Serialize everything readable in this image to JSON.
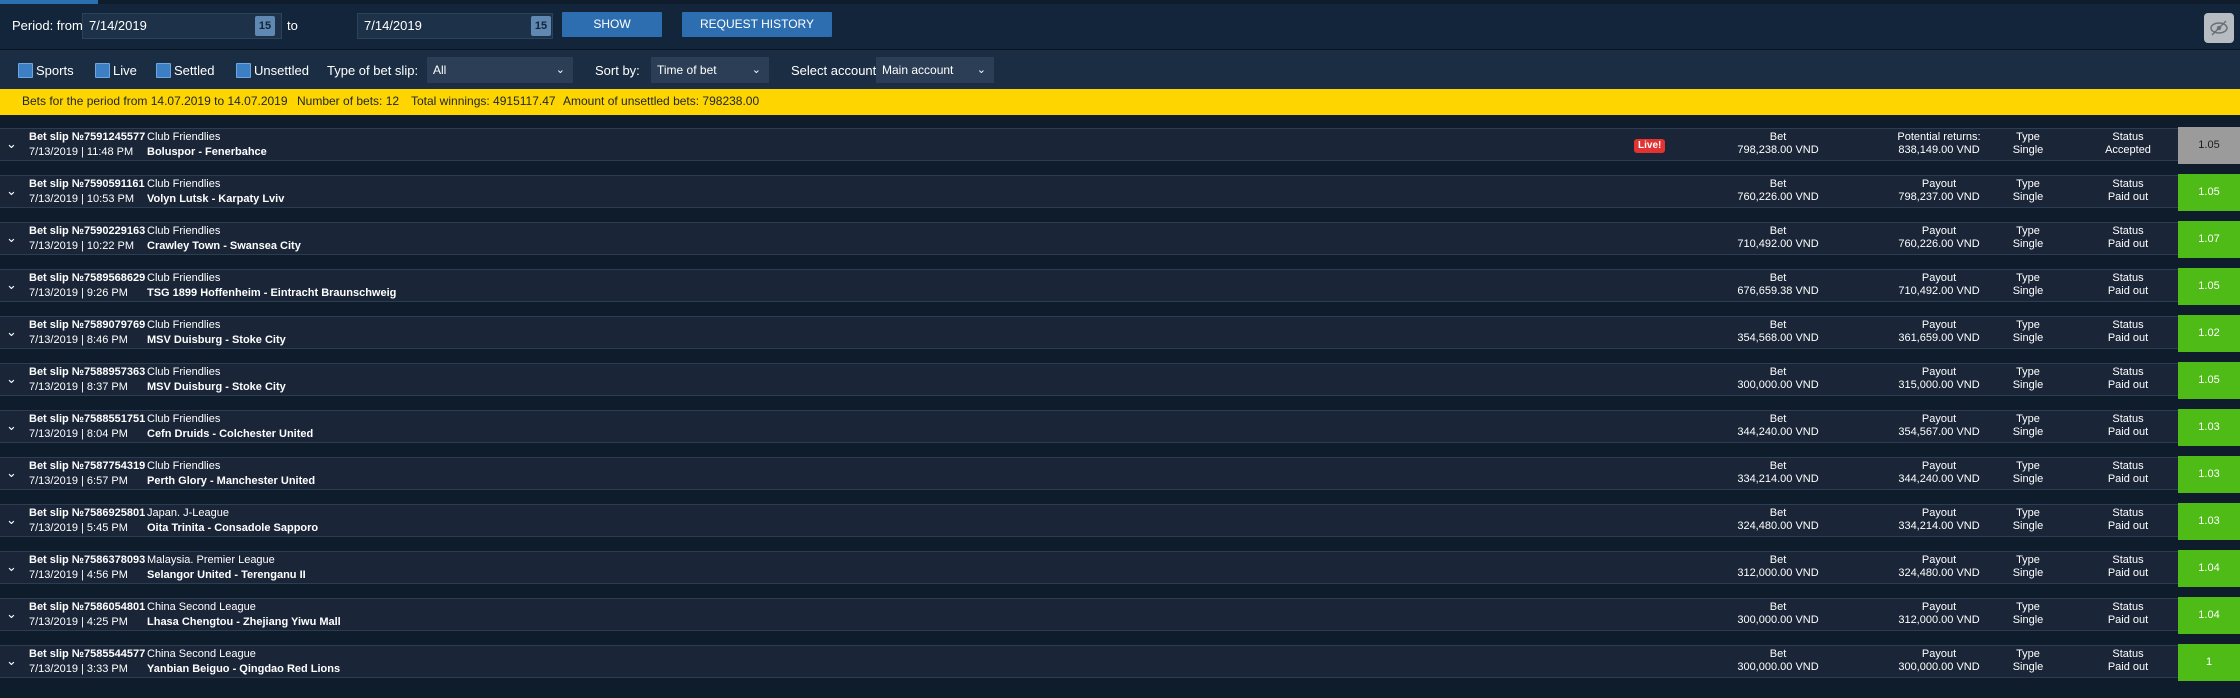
{
  "filters": {
    "period_from_label": "Period: from",
    "from_date": "7/14/2019",
    "to_label": "to",
    "to_date": "7/14/2019",
    "calendar_icon_text": "15",
    "show_button": "SHOW",
    "history_button": "REQUEST HISTORY"
  },
  "options": {
    "checkboxes": [
      "Sports",
      "Live",
      "Settled",
      "Unsettled"
    ],
    "bet_type_label": "Type of bet slip:",
    "bet_type_value": "All",
    "sort_label": "Sort by:",
    "sort_value": "Time of bet",
    "account_label": "Select account:",
    "account_value": "Main account"
  },
  "summary": {
    "period": "Bets for the period from 14.07.2019 to 14.07.2019",
    "count": "Number of bets: 12",
    "winnings": "Total winnings: 4915117.47",
    "unsettled": "Amount of unsettled bets: 798238.00"
  },
  "labels": {
    "bet": "Bet",
    "type": "Type",
    "status": "Status",
    "live": "Live!"
  },
  "colors": {
    "summary_bar": "#ffd500",
    "odds_paid": "#4ebb17",
    "odds_pending": "#9b9b9b",
    "live_badge": "#e23232",
    "button": "#2c6eb0"
  },
  "bets": [
    {
      "slip": "Bet slip №7591245577",
      "datetime": "7/13/2019 | 11:48 PM",
      "league": "Club Friendlies",
      "match": "Boluspor - Fenerbahce",
      "live": true,
      "bet": "798,238.00 VND",
      "payout_label": "Potential returns:",
      "payout": "838,149.00 VND",
      "type": "Single",
      "status": "Accepted",
      "odds": "1.05",
      "pending": true
    },
    {
      "slip": "Bet slip №7590591161",
      "datetime": "7/13/2019 | 10:53 PM",
      "league": "Club Friendlies",
      "match": "Volyn Lutsk - Karpaty Lviv",
      "live": false,
      "bet": "760,226.00 VND",
      "payout_label": "Payout",
      "payout": "798,237.00 VND",
      "type": "Single",
      "status": "Paid out",
      "odds": "1.05",
      "pending": false
    },
    {
      "slip": "Bet slip №7590229163",
      "datetime": "7/13/2019 | 10:22 PM",
      "league": "Club Friendlies",
      "match": "Crawley Town - Swansea City",
      "live": false,
      "bet": "710,492.00 VND",
      "payout_label": "Payout",
      "payout": "760,226.00 VND",
      "type": "Single",
      "status": "Paid out",
      "odds": "1.07",
      "pending": false
    },
    {
      "slip": "Bet slip №7589568629",
      "datetime": "7/13/2019 | 9:26 PM",
      "league": "Club Friendlies",
      "match": "TSG 1899 Hoffenheim - Eintracht Braunschweig",
      "live": false,
      "bet": "676,659.38 VND",
      "payout_label": "Payout",
      "payout": "710,492.00 VND",
      "type": "Single",
      "status": "Paid out",
      "odds": "1.05",
      "pending": false
    },
    {
      "slip": "Bet slip №7589079769",
      "datetime": "7/13/2019 | 8:46 PM",
      "league": "Club Friendlies",
      "match": "MSV Duisburg - Stoke City",
      "live": false,
      "bet": "354,568.00 VND",
      "payout_label": "Payout",
      "payout": "361,659.00 VND",
      "type": "Single",
      "status": "Paid out",
      "odds": "1.02",
      "pending": false
    },
    {
      "slip": "Bet slip №7588957363",
      "datetime": "7/13/2019 | 8:37 PM",
      "league": "Club Friendlies",
      "match": "MSV Duisburg - Stoke City",
      "live": false,
      "bet": "300,000.00 VND",
      "payout_label": "Payout",
      "payout": "315,000.00 VND",
      "type": "Single",
      "status": "Paid out",
      "odds": "1.05",
      "pending": false
    },
    {
      "slip": "Bet slip №7588551751",
      "datetime": "7/13/2019 | 8:04 PM",
      "league": "Club Friendlies",
      "match": "Cefn Druids - Colchester United",
      "live": false,
      "bet": "344,240.00 VND",
      "payout_label": "Payout",
      "payout": "354,567.00 VND",
      "type": "Single",
      "status": "Paid out",
      "odds": "1.03",
      "pending": false
    },
    {
      "slip": "Bet slip №7587754319",
      "datetime": "7/13/2019 | 6:57 PM",
      "league": "Club Friendlies",
      "match": "Perth Glory - Manchester United",
      "live": false,
      "bet": "334,214.00 VND",
      "payout_label": "Payout",
      "payout": "344,240.00 VND",
      "type": "Single",
      "status": "Paid out",
      "odds": "1.03",
      "pending": false
    },
    {
      "slip": "Bet slip №7586925801",
      "datetime": "7/13/2019 | 5:45 PM",
      "league": "Japan. J-League",
      "match": "Oita Trinita - Consadole Sapporo",
      "live": false,
      "bet": "324,480.00 VND",
      "payout_label": "Payout",
      "payout": "334,214.00 VND",
      "type": "Single",
      "status": "Paid out",
      "odds": "1.03",
      "pending": false
    },
    {
      "slip": "Bet slip №7586378093",
      "datetime": "7/13/2019 | 4:56 PM",
      "league": "Malaysia. Premier League",
      "match": "Selangor United - Terenganu II",
      "live": false,
      "bet": "312,000.00 VND",
      "payout_label": "Payout",
      "payout": "324,480.00 VND",
      "type": "Single",
      "status": "Paid out",
      "odds": "1.04",
      "pending": false
    },
    {
      "slip": "Bet slip №7586054801",
      "datetime": "7/13/2019 | 4:25 PM",
      "league": "China Second League",
      "match": "Lhasa Chengtou - Zhejiang Yiwu Mall",
      "live": false,
      "bet": "300,000.00 VND",
      "payout_label": "Payout",
      "payout": "312,000.00 VND",
      "type": "Single",
      "status": "Paid out",
      "odds": "1.04",
      "pending": false
    },
    {
      "slip": "Bet slip №7585544577",
      "datetime": "7/13/2019 | 3:33 PM",
      "league": "China Second League",
      "match": "Yanbian Beiguo - Qingdao Red Lions",
      "live": false,
      "bet": "300,000.00 VND",
      "payout_label": "Payout",
      "payout": "300,000.00 VND",
      "type": "Single",
      "status": "Paid out",
      "odds": "1",
      "pending": false
    }
  ]
}
